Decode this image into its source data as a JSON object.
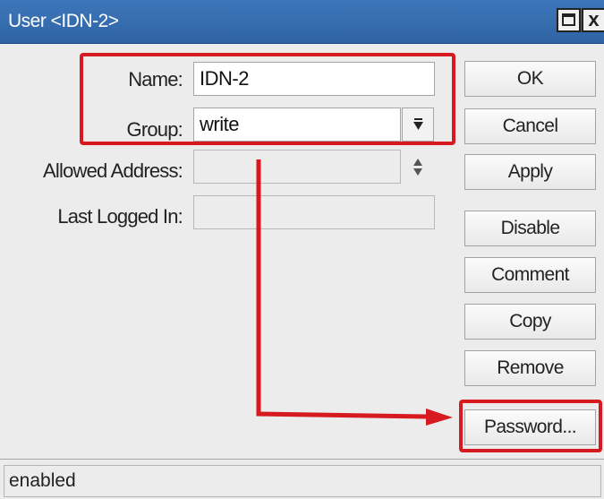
{
  "window": {
    "title": "User <IDN-2>",
    "close_glyph": "x"
  },
  "form": {
    "name_label": "Name:",
    "name_value": "IDN-2",
    "group_label": "Group:",
    "group_value": "write",
    "allowed_address_label": "Allowed Address:",
    "allowed_address_value": "",
    "last_logged_in_label": "Last Logged In:",
    "last_logged_in_value": ""
  },
  "buttons": {
    "ok": "OK",
    "cancel": "Cancel",
    "apply": "Apply",
    "disable": "Disable",
    "comment": "Comment",
    "copy": "Copy",
    "remove": "Remove",
    "password": "Password..."
  },
  "status": {
    "text": "enabled"
  },
  "annotation_color": "#d71920",
  "icons": [
    "maximize-icon",
    "close-icon",
    "dropdown-arrow-icon",
    "updown-arrows-icon",
    "red-arrow"
  ]
}
